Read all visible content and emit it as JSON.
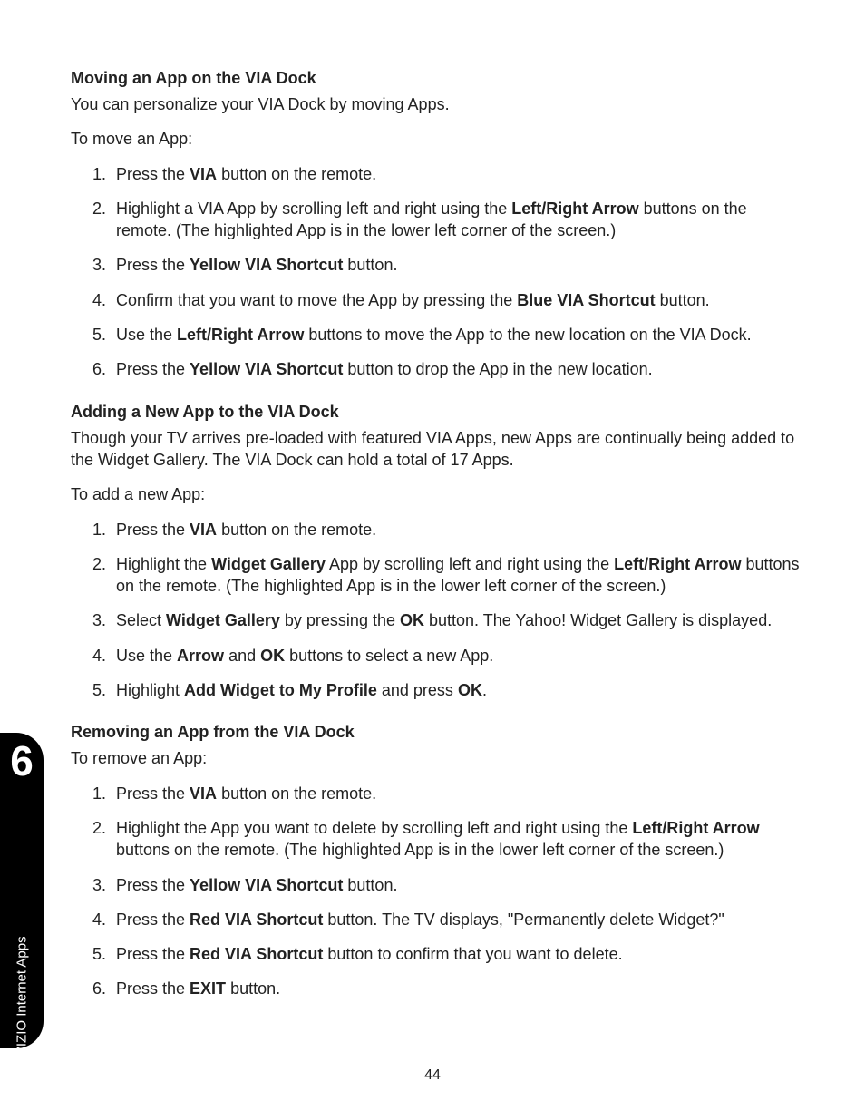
{
  "pageNumber": "44",
  "sideTab": {
    "chapterNum": "6",
    "label": "Using VIZIO Internet Apps"
  },
  "sections": [
    {
      "heading": "Moving an App on the VIA Dock",
      "intro": [
        "You can personalize your VIA Dock by moving Apps.",
        "To move an App:"
      ],
      "steps": [
        [
          {
            "t": "Press the "
          },
          {
            "b": "VIA"
          },
          {
            "t": " button on the remote."
          }
        ],
        [
          {
            "t": "Highlight a VIA App by scrolling left and right using the "
          },
          {
            "b": "Left/Right Arrow"
          },
          {
            "t": " buttons on the remote. (The highlighted App is in the lower left corner of the screen.)"
          }
        ],
        [
          {
            "t": "Press the "
          },
          {
            "b": "Yellow VIA Shortcut"
          },
          {
            "t": " button."
          }
        ],
        [
          {
            "t": "Confirm that you want to move the App by pressing the "
          },
          {
            "b": "Blue VIA Shortcut"
          },
          {
            "t": " button."
          }
        ],
        [
          {
            "t": "Use the "
          },
          {
            "b": "Left/Right Arrow"
          },
          {
            "t": " buttons to move the App to the new location on the VIA Dock."
          }
        ],
        [
          {
            "t": "Press the "
          },
          {
            "b": "Yellow VIA Shortcut"
          },
          {
            "t": " button to drop the App in the new location."
          }
        ]
      ]
    },
    {
      "heading": "Adding a New App to the VIA Dock",
      "intro": [
        "Though your TV arrives pre-loaded with featured VIA Apps, new Apps are continually being added to the Widget Gallery. The VIA Dock can hold a total of 17 Apps.",
        "To add a new App:"
      ],
      "steps": [
        [
          {
            "t": "Press the "
          },
          {
            "b": "VIA"
          },
          {
            "t": " button on the remote."
          }
        ],
        [
          {
            "t": "Highlight the "
          },
          {
            "b": "Widget Gallery"
          },
          {
            "t": " App by scrolling left and right using the "
          },
          {
            "b": "Left/Right Arrow"
          },
          {
            "t": " buttons on the remote. (The highlighted App is in the lower left corner of the screen.)"
          }
        ],
        [
          {
            "t": "Select "
          },
          {
            "b": "Widget Gallery"
          },
          {
            "t": " by pressing the "
          },
          {
            "b": "OK"
          },
          {
            "t": " button. The Yahoo! Widget Gallery is displayed."
          }
        ],
        [
          {
            "t": "Use the "
          },
          {
            "b": "Arrow"
          },
          {
            "t": " and "
          },
          {
            "b": "OK"
          },
          {
            "t": " buttons to select a new App."
          }
        ],
        [
          {
            "t": "Highlight "
          },
          {
            "b": "Add Widget to My Profile"
          },
          {
            "t": " and press "
          },
          {
            "b": "OK"
          },
          {
            "t": "."
          }
        ]
      ]
    },
    {
      "heading": "Removing an App from the VIA Dock",
      "intro": [
        "To remove an App:"
      ],
      "steps": [
        [
          {
            "t": "Press the "
          },
          {
            "b": "VIA"
          },
          {
            "t": " button on the remote."
          }
        ],
        [
          {
            "t": "Highlight the App you want to delete by scrolling left and right using the "
          },
          {
            "b": "Left/Right Arrow"
          },
          {
            "t": " buttons on the remote. (The highlighted App is in the lower left corner of the screen.)"
          }
        ],
        [
          {
            "t": "Press the "
          },
          {
            "b": "Yellow VIA Shortcut"
          },
          {
            "t": " button."
          }
        ],
        [
          {
            "t": "Press the "
          },
          {
            "b": "Red VIA Shortcut"
          },
          {
            "t": " button. The TV displays, \"Permanently delete Widget?\""
          }
        ],
        [
          {
            "t": "Press the "
          },
          {
            "b": "Red VIA Shortcut"
          },
          {
            "t": " button to confirm that you want to delete."
          }
        ],
        [
          {
            "t": "Press the "
          },
          {
            "b": "EXIT"
          },
          {
            "t": " button."
          }
        ]
      ]
    }
  ]
}
